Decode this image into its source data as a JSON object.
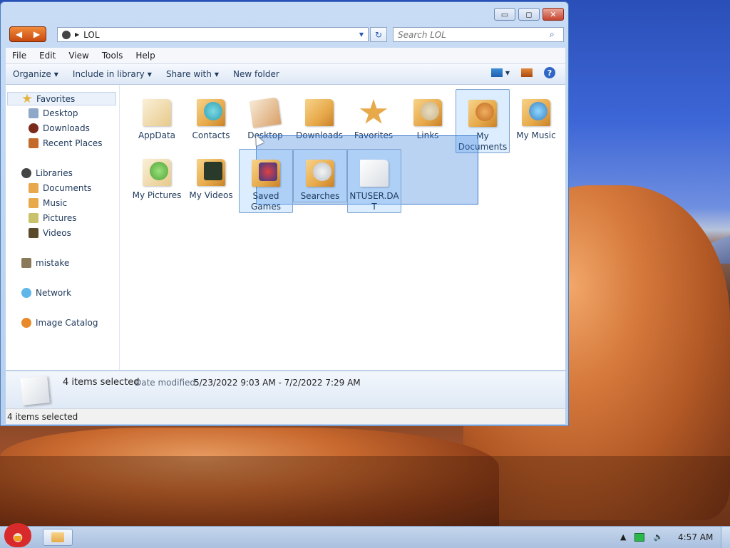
{
  "window": {
    "controls": {
      "minimize": "▭",
      "maximize": "◻",
      "close": "✕"
    },
    "breadcrumb": "LOL",
    "search_placeholder": "Search LOL"
  },
  "menu": [
    "File",
    "Edit",
    "View",
    "Tools",
    "Help"
  ],
  "toolbar": {
    "organize": "Organize",
    "include": "Include in library",
    "share": "Share with",
    "newfolder": "New folder",
    "help": "?"
  },
  "sidebar": {
    "favorites": "Favorites",
    "desktop": "Desktop",
    "downloads": "Downloads",
    "recent": "Recent Places",
    "libraries": "Libraries",
    "documents": "Documents",
    "music": "Music",
    "pictures": "Pictures",
    "videos": "Videos",
    "mistake": "mistake",
    "network": "Network",
    "catalog": "Image Catalog"
  },
  "items": [
    {
      "label": "AppData"
    },
    {
      "label": "Contacts"
    },
    {
      "label": "Desktop"
    },
    {
      "label": "Downloads"
    },
    {
      "label": "Favorites"
    },
    {
      "label": "Links"
    },
    {
      "label": "My Documents"
    },
    {
      "label": "My Music"
    },
    {
      "label": "My Pictures"
    },
    {
      "label": "My Videos"
    },
    {
      "label": "Saved Games"
    },
    {
      "label": "Searches"
    },
    {
      "label": "NTUSER.DAT"
    }
  ],
  "details": {
    "count": "4 items selected",
    "modified_label": "Date modified:",
    "modified_value": "5/23/2022 9:03 AM - 7/2/2022 7:29 AM"
  },
  "status": "4 items selected",
  "taskbar": {
    "clock": "4:57 AM"
  },
  "colors": {
    "accent": "#3a78cc",
    "selection": "#99ccff",
    "titlebar": "#c9dcf5"
  }
}
